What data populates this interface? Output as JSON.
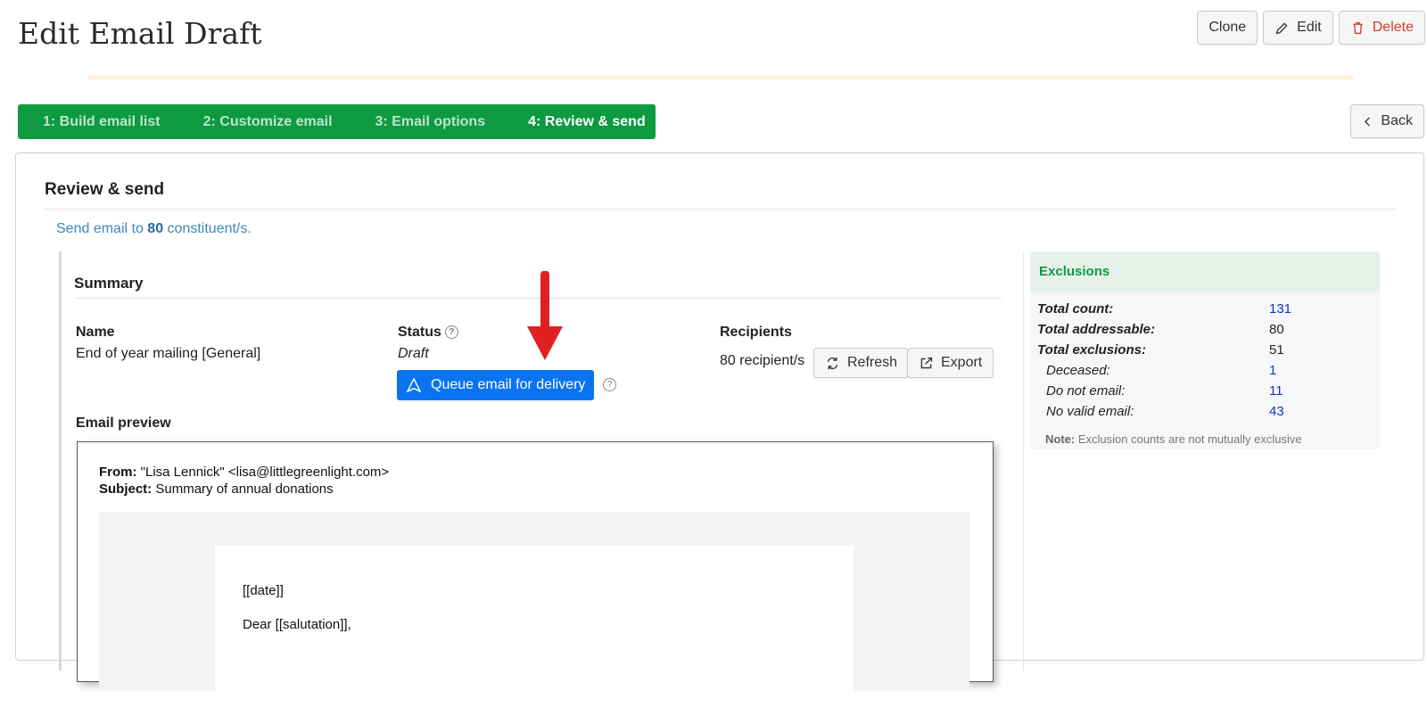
{
  "header": {
    "title": "Edit Email Draft",
    "clone_label": "Clone",
    "edit_label": "Edit",
    "delete_label": "Delete",
    "back_label": "Back"
  },
  "steps": [
    {
      "label": "1: Build email list",
      "active": false
    },
    {
      "label": "2: Customize email",
      "active": false
    },
    {
      "label": "3: Email options",
      "active": false
    },
    {
      "label": "4: Review & send",
      "active": true
    }
  ],
  "review": {
    "title": "Review & send",
    "send_prefix": "Send email to",
    "send_count": "80",
    "send_suffix": "constituent/s."
  },
  "summary": {
    "title": "Summary",
    "name_label": "Name",
    "name_value": "End of year mailing [General]",
    "status_label": "Status",
    "status_value": "Draft",
    "queue_label": "Queue email for delivery",
    "recipients_label": "Recipients",
    "recipients_value": "80 recipient/s",
    "refresh_label": "Refresh",
    "export_label": "Export",
    "preview_label": "Email preview"
  },
  "preview": {
    "from_label": "From:",
    "from_value": "\"Lisa Lennick\" <lisa@littlegreenlight.com>",
    "subject_label": "Subject:",
    "subject_value": "Summary of annual donations",
    "line1": "[[date]]",
    "line2": "Dear [[salutation]],"
  },
  "exclusions": {
    "title": "Exclusions",
    "rows": [
      {
        "label": "Total count:",
        "value": "131"
      },
      {
        "label": "Total addressable:",
        "value": "80"
      },
      {
        "label": "Total exclusions:",
        "value": "51"
      },
      {
        "label": "Deceased:",
        "value": "1"
      },
      {
        "label": "Do not email:",
        "value": "11"
      },
      {
        "label": "No valid email:",
        "value": "43"
      }
    ],
    "note_label": "Note:",
    "note_text": "Exclusion counts are not mutually exclusive"
  },
  "colors": {
    "steps_bg": "#0d9a41",
    "primary_button": "#0a74f0",
    "arrow": "#e02020",
    "link": "#1a2fbf"
  }
}
